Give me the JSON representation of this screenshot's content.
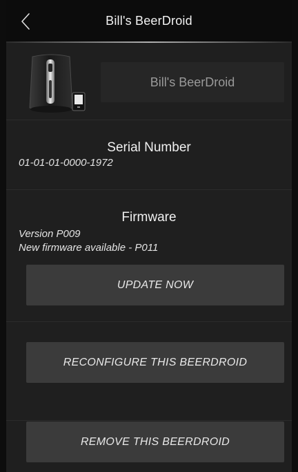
{
  "header": {
    "title": "Bill's BeerDroid",
    "back_icon": "chevron-left-icon"
  },
  "device": {
    "image": "beerdroid-device-image",
    "name_value": "Bill's BeerDroid"
  },
  "serial": {
    "heading": "Serial Number",
    "value": "01-01-01-0000-1972"
  },
  "firmware": {
    "heading": "Firmware",
    "version": "Version P009",
    "available": "New firmware available - P011",
    "update_label": "UPDATE NOW"
  },
  "actions": {
    "reconfigure_label": "RECONFIGURE THIS BEERDROID",
    "remove_label": "REMOVE THIS BEERDROID"
  },
  "colors": {
    "background": "#1f1f1f",
    "header": "#0c0c0c",
    "button": "#3b3b3b",
    "text": "#e6e6e6"
  }
}
